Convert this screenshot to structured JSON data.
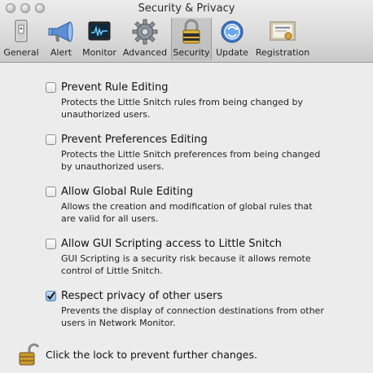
{
  "window": {
    "title": "Security & Privacy"
  },
  "toolbar": {
    "items": [
      {
        "label": "General",
        "icon": "general-switch-icon"
      },
      {
        "label": "Alert",
        "icon": "megaphone-icon"
      },
      {
        "label": "Monitor",
        "icon": "monitor-icon"
      },
      {
        "label": "Advanced",
        "icon": "gear-icon"
      },
      {
        "label": "Security",
        "icon": "lock-icon",
        "selected": true
      },
      {
        "label": "Update",
        "icon": "update-globe-icon"
      },
      {
        "label": "Registration",
        "icon": "license-certificate-icon"
      }
    ]
  },
  "options": [
    {
      "title": "Prevent Rule Editing",
      "description": [
        "Protects the Little Snitch rules from being changed by",
        "unauthorized users."
      ],
      "checked": false
    },
    {
      "title": "Prevent Preferences Editing",
      "description": [
        "Protects the Little Snitch preferences from being changed",
        "by unauthorized users."
      ],
      "checked": false
    },
    {
      "title": "Allow Global Rule Editing",
      "description": [
        "Allows the creation and modification of global rules that",
        "are valid for all users."
      ],
      "checked": false
    },
    {
      "title": "Allow GUI Scripting access to Little Snitch",
      "description": [
        "GUI Scripting is a security risk because it allows remote",
        "control of Little Snitch."
      ],
      "checked": false
    },
    {
      "title": "Respect privacy of other users",
      "description": [
        "Prevents the display of connection destinations from other",
        "users in Network Monitor."
      ],
      "checked": true
    }
  ],
  "lock": {
    "text": "Click the lock to prevent further changes.",
    "state": "unlocked"
  }
}
